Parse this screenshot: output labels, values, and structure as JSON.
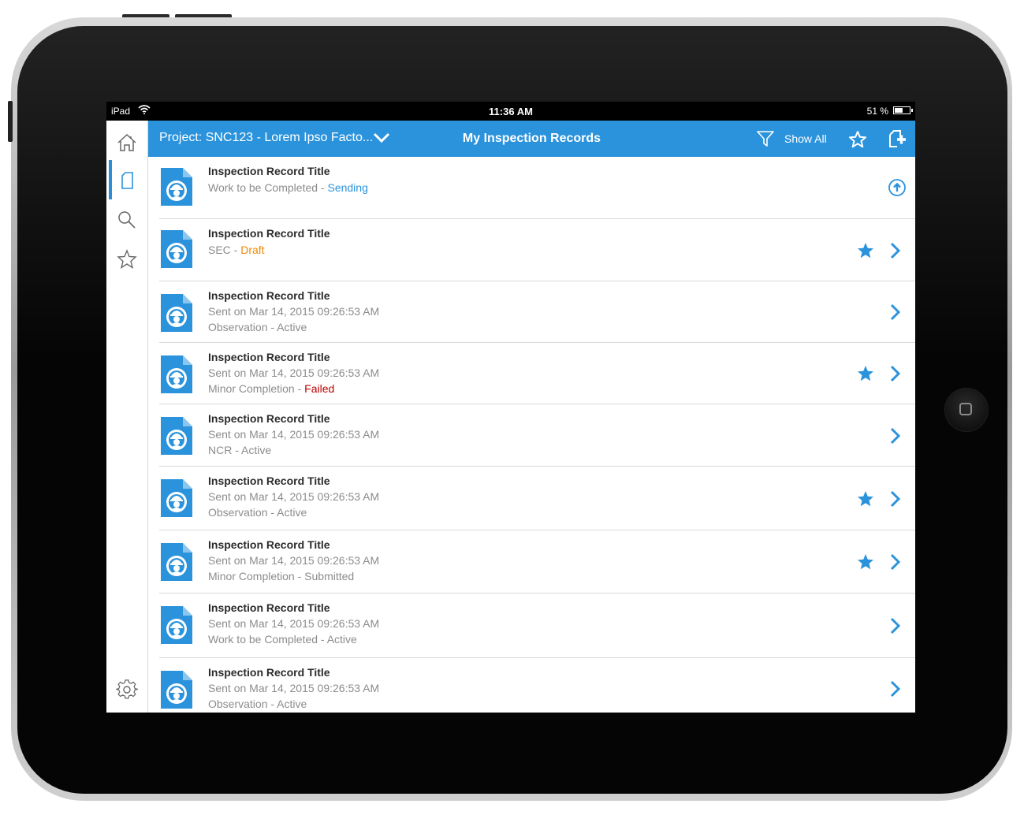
{
  "device": {
    "status": {
      "carrier": "iPad",
      "time": "11:36 AM",
      "battery": "51 %"
    }
  },
  "header": {
    "project": "Project: SNC123 - Lorem Ipso Facto...",
    "title": "My Inspection Records",
    "show_all": "Show All",
    "accent_color": "#2b93dc"
  },
  "sidebar": {
    "items": [
      "home-icon",
      "document-icon",
      "search-icon",
      "star-icon",
      "gear-icon"
    ],
    "active": "document-icon"
  },
  "records": [
    {
      "title": "Inspection Record Title",
      "line1_prefix": "Work to be Completed - ",
      "line1_status": "Sending",
      "line2_prefix": "",
      "line2_status": "",
      "starred": false,
      "action": "upload"
    },
    {
      "title": "Inspection Record Title",
      "line1_prefix": "SEC - ",
      "line1_status": "Draft",
      "line2_prefix": "",
      "line2_status": "",
      "starred": true,
      "action": "chevron"
    },
    {
      "title": "Inspection Record Title",
      "line1_prefix": "Sent on Mar 14, 2015 09:26:53 AM",
      "line1_status": "",
      "line2_prefix": "Observation - ",
      "line2_status": "Active",
      "starred": false,
      "action": "chevron"
    },
    {
      "title": "Inspection Record Title",
      "line1_prefix": "Sent on Mar 14, 2015 09:26:53 AM",
      "line1_status": "",
      "line2_prefix": "Minor Completion - ",
      "line2_status": "Failed",
      "starred": true,
      "action": "chevron"
    },
    {
      "title": "Inspection Record Title",
      "line1_prefix": "Sent on Mar 14, 2015 09:26:53 AM",
      "line1_status": "",
      "line2_prefix": "NCR - ",
      "line2_status": "Active",
      "starred": false,
      "action": "chevron"
    },
    {
      "title": "Inspection Record Title",
      "line1_prefix": "Sent on Mar 14, 2015 09:26:53 AM",
      "line1_status": "",
      "line2_prefix": "Observation - ",
      "line2_status": "Active",
      "starred": true,
      "action": "chevron"
    },
    {
      "title": "Inspection Record Title",
      "line1_prefix": "Sent on Mar 14, 2015 09:26:53 AM",
      "line1_status": "",
      "line2_prefix": "Minor Completion - ",
      "line2_status": "Submitted",
      "starred": true,
      "action": "chevron"
    },
    {
      "title": "Inspection Record Title",
      "line1_prefix": "Sent on Mar 14, 2015 09:26:53 AM",
      "line1_status": "",
      "line2_prefix": "Work to be Completed - ",
      "line2_status": "Active",
      "starred": false,
      "action": "chevron"
    },
    {
      "title": "Inspection Record Title",
      "line1_prefix": "Sent on Mar 14, 2015 09:26:53 AM",
      "line1_status": "",
      "line2_prefix": "Observation - ",
      "line2_status": "Active",
      "starred": false,
      "action": "chevron"
    }
  ]
}
